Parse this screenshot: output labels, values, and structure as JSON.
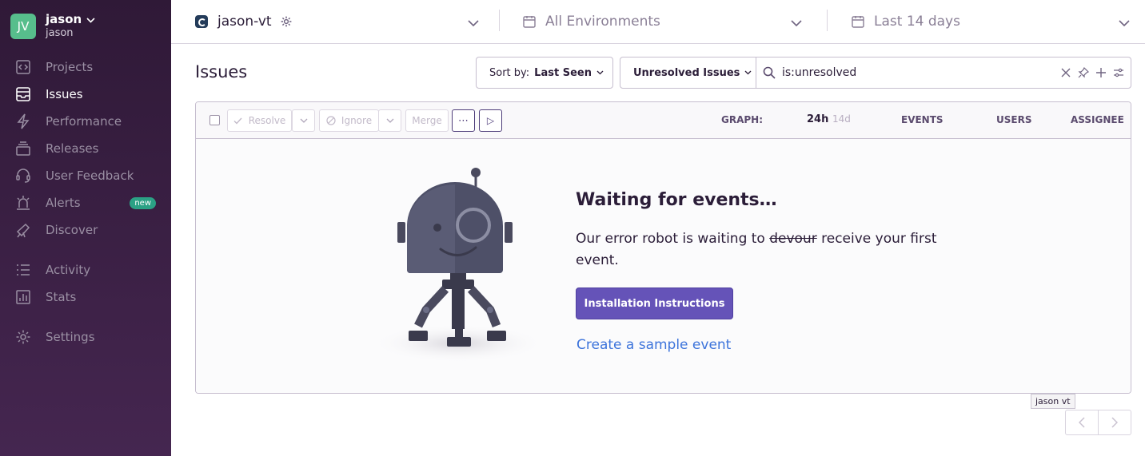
{
  "sidebar": {
    "org_initials": "JV",
    "org_name": "jason",
    "org_user": "jason",
    "items": [
      {
        "label": "Projects"
      },
      {
        "label": "Issues"
      },
      {
        "label": "Performance"
      },
      {
        "label": "Releases"
      },
      {
        "label": "User Feedback"
      },
      {
        "label": "Alerts",
        "badge": "new"
      },
      {
        "label": "Discover"
      },
      {
        "label": "Activity"
      },
      {
        "label": "Stats"
      },
      {
        "label": "Settings"
      }
    ]
  },
  "header": {
    "project": "jason-vt",
    "environment": "All Environments",
    "date_range": "Last 14 days"
  },
  "page": {
    "title": "Issues",
    "sort_label": "Sort by:",
    "sort_value": "Last Seen",
    "saved_search": "Unresolved Issues",
    "search_query": "is:unresolved"
  },
  "toolbar": {
    "resolve": "Resolve",
    "ignore": "Ignore",
    "merge": "Merge",
    "more": "⋯",
    "play": "▷",
    "graph_label": "GRAPH:",
    "graph_24h": "24h",
    "graph_14d": "14d",
    "events": "EVENTS",
    "users": "USERS",
    "assignee": "ASSIGNEE"
  },
  "empty_state": {
    "title": "Waiting for events…",
    "desc_before": "Our error robot is waiting to ",
    "desc_strike": "devour",
    "desc_after": " receive your first event.",
    "install_button": "Installation Instructions",
    "sample_link": "Create a sample event"
  },
  "tooltip": "jason vt",
  "colors": {
    "sidebar_top": "#2f1937",
    "accent": "#6553b8",
    "link": "#3d74db",
    "avatar": "#57be8c",
    "badge": "#2ba185"
  }
}
